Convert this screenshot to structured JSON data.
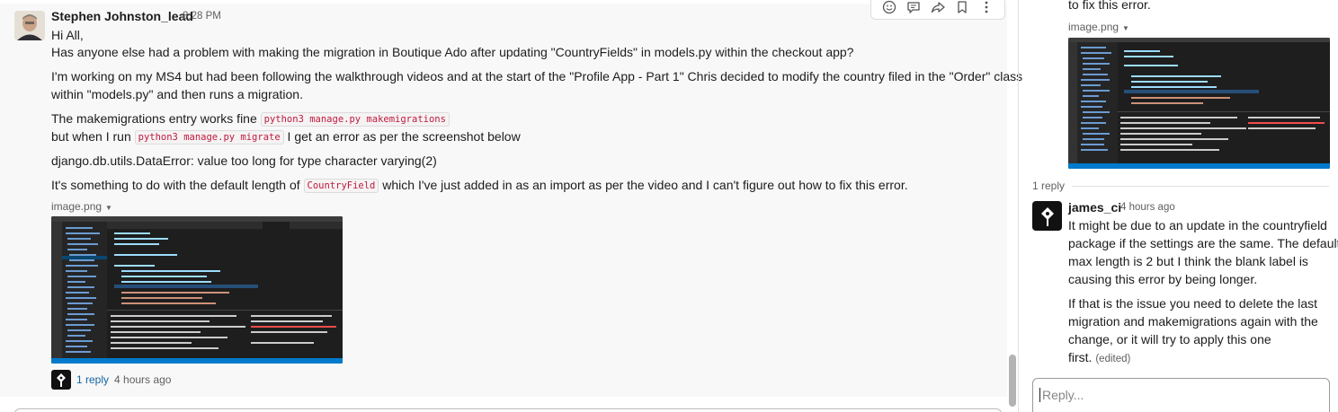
{
  "message": {
    "author": "Stephen Johnston_lead",
    "time": "8:28 PM",
    "p1": "Hi All,",
    "p2": "Has anyone else had a problem with making the migration in Boutique Ado after updating \"CountryFields\" in models.py within the checkout app?",
    "p3a": "I'm working on my MS4 but had been following the walkthrough videos and at the start of the \"Profile App - Part 1\" Chris decided to modify the country filed in the \"Order\" class",
    "p3b": "within \"models.py\" and then runs a migration.",
    "p4_prefix": "The makemigrations entry works fine ",
    "p4_code": "python3 manage.py makemigrations",
    "p5_prefix": "but when I run ",
    "p5_code": "python3 manage.py migrate",
    "p5_suffix": " I get an error as per the screenshot below",
    "p6": "django.db.utils.DataError: value too long for type character varying(2)",
    "p7_prefix": "It's something to do with the default length of ",
    "p7_code": "CountryField",
    "p7_suffix": " which I've just added in as an import as per the video and I can't figure out how to fix this error.",
    "attachment_name": "image.png",
    "reply_count": "1 reply",
    "reply_time": "4 hours ago"
  },
  "toolbar": {
    "icons": [
      "emoji-reaction-icon",
      "reply-thread-icon",
      "share-icon",
      "bookmark-icon",
      "more-icon"
    ]
  },
  "thread": {
    "top_text": "to fix this error.",
    "attachment_name": "image.png",
    "replies_label": "1 reply",
    "reply": {
      "author": "james_ci",
      "time": "4 hours ago",
      "l1": "It might be due to an update in the countryfield",
      "l2": "package if the settings are the same. The default",
      "l3": "max length is 2 but I think the blank label is",
      "l4": "causing this error by being longer.",
      "l5": "If that is the issue you need to delete the last",
      "l6": "migration and makemigrations again with the",
      "l7": "change, or it will try to apply this one",
      "l8": "first.",
      "edited": "(edited)"
    },
    "composer_placeholder": "Reply..."
  }
}
